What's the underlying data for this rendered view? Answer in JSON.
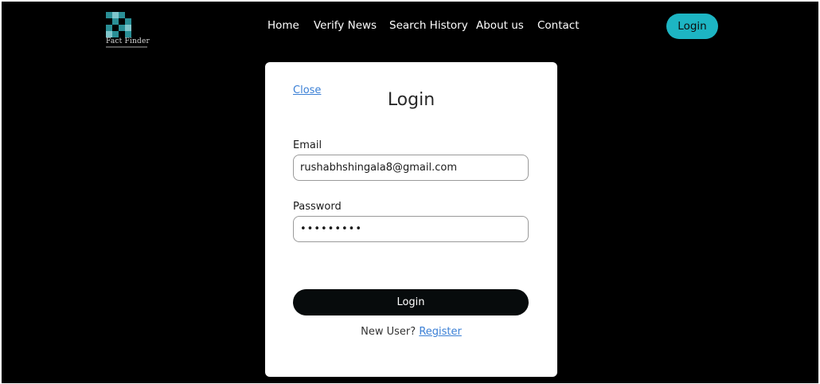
{
  "brand": {
    "name": "Fact Finder",
    "logo_color": "#2a8f96"
  },
  "nav": {
    "items": [
      {
        "label": "Home"
      },
      {
        "label": "Verify News"
      },
      {
        "label": "Search History"
      },
      {
        "label": "About us"
      },
      {
        "label": "Contact"
      }
    ],
    "login_label": "Login"
  },
  "modal": {
    "close_label": "Close",
    "title": "Login",
    "email_label": "Email",
    "email_value": "rushabhshingala8@gmail.com",
    "password_label": "Password",
    "password_value": "•••••••••",
    "submit_label": "Login",
    "new_user_text": "New User?",
    "register_label": "Register"
  },
  "colors": {
    "background": "#000000",
    "accent": "#1db5c3",
    "link": "#3a7fd5"
  }
}
